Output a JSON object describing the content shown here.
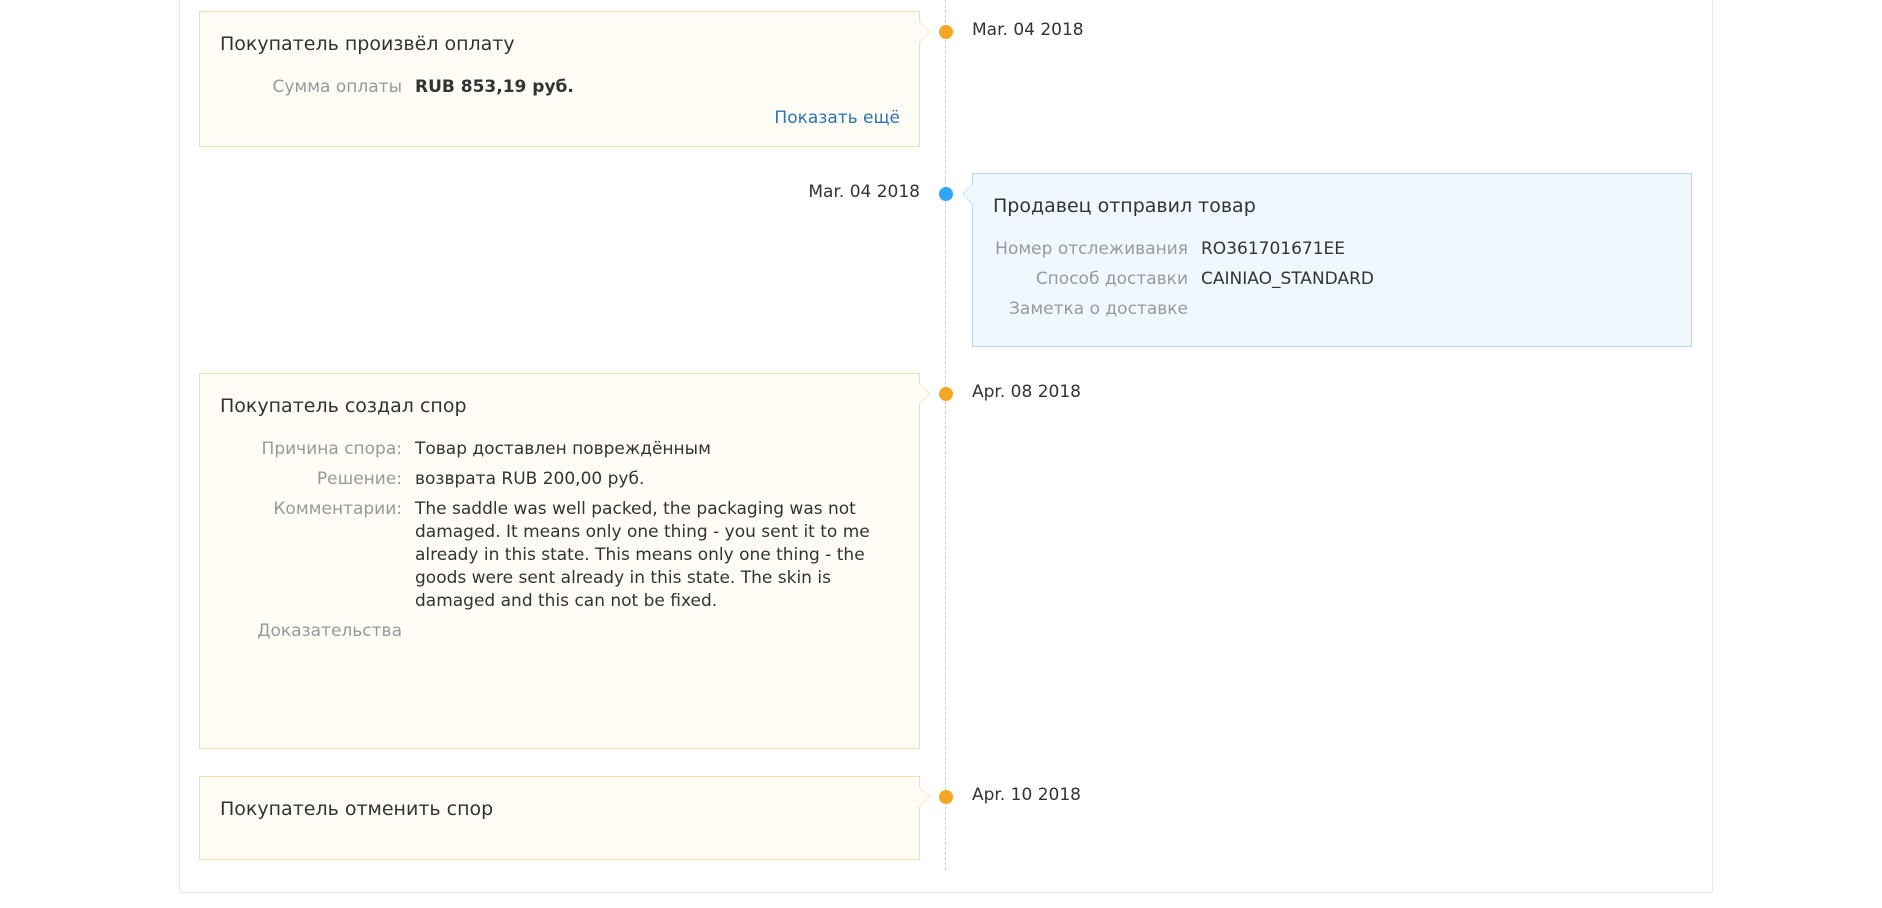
{
  "events": [
    {
      "side": "left",
      "color": "#f5a623",
      "date": "Mar. 04 2018",
      "title": "Покупатель произвёл оплату",
      "fields": [
        {
          "label": "Сумма оплаты",
          "value": "RUB 853,19 руб."
        }
      ],
      "link": "Показать ещё"
    },
    {
      "side": "right",
      "color": "#2ea7f2",
      "date": "Mar. 04 2018",
      "title": "Продавец отправил товар",
      "fields": [
        {
          "label": "Номер отслеживания",
          "value": "RO361701671EE"
        },
        {
          "label": "Способ доставки",
          "value": "CAINIAO_STANDARD"
        },
        {
          "label": "Заметка о доставке",
          "value": ""
        }
      ]
    },
    {
      "side": "left",
      "color": "#f5a623",
      "date": "Apr. 08 2018",
      "title": "Покупатель создал спор",
      "fields": [
        {
          "label": "Причина спора:",
          "value": "Товар доставлен повреждённым"
        },
        {
          "label": "Решение:",
          "value": "возврата RUB 200,00 руб."
        },
        {
          "label": "Комментарии:",
          "value": "The saddle was well packed, the packaging was not damaged. It means only one thing - you sent it to me already in this state. This means only one thing - the goods were sent already in this state. The skin is damaged and this can not be fixed."
        },
        {
          "label": "Доказательства",
          "value": ""
        }
      ]
    },
    {
      "side": "left",
      "color": "#f5a623",
      "date": "Apr. 10 2018",
      "title": "Покупатель отменить спор",
      "fields": []
    }
  ]
}
